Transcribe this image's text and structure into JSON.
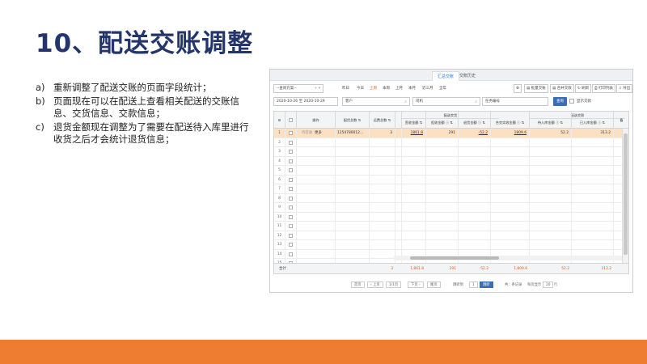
{
  "slide": {
    "title": "10、配送交账调整",
    "bullets": [
      {
        "marker": "a)",
        "text": "重新调整了配送交账的页面字段统计；"
      },
      {
        "marker": "b)",
        "text": "页面现在可以在配送上查看相关配送的交账信息、交货信息、交款信息；"
      },
      {
        "marker": "c)",
        "text": "退货金额现在调整为了需要在配送待入库里进行收货之后才会统计退货信息；"
      }
    ],
    "accent_color": "#ee7d31",
    "title_color": "#24356c"
  },
  "app": {
    "tabs": [
      "汇总交账",
      "交账历史"
    ],
    "active_tab": "汇总交账",
    "scheme_select": "--查询方案--",
    "quick_dates": [
      "昨日",
      "今日",
      "上周",
      "本周",
      "上月",
      "本月",
      "近三月",
      "全年"
    ],
    "active_quick_date": "上周",
    "toolbar_buttons": [
      "批量交账",
      "合并交款",
      "刷新",
      "打印列表",
      "导出"
    ],
    "date_range": "2020-10-26  至  2020-10-29",
    "customer_placeholder": "客户",
    "driver_placeholder": "司机",
    "order_placeholder": "任务编号",
    "query_button": "查询",
    "show_voided_label": "显示交款",
    "grid": {
      "group_headers": [
        "配送交货",
        "配送交款"
      ],
      "headers": [
        "",
        "",
        "操作",
        "配货总数",
        "运费总数",
        "",
        "签收金额",
        "拒收金额",
        "退货金额",
        "合交实收金额",
        "待入库金额",
        "已入库金额",
        "备"
      ],
      "row_numbers": [
        "1",
        "2",
        "3",
        "4",
        "5",
        "6",
        "7",
        "8",
        "9",
        "10",
        "11",
        "12",
        "13",
        "14",
        "15"
      ],
      "selected_row": {
        "op_a": "待签收",
        "op_b": "更多",
        "order": "1254780012...",
        "count": "3",
        "sign": "1861.8",
        "reject": "291",
        "ret": "-52.2",
        "actual": "1809.6",
        "pending": "52.2",
        "stocked": "313.2"
      },
      "summary": {
        "label": "合计",
        "count": "3",
        "sign": "1,861.8",
        "reject": "291",
        "ret": "-52.2",
        "actual": "1,809.6",
        "pending": "52.2",
        "stocked": "313.2"
      }
    },
    "pager": {
      "first": "首页",
      "prev": "上页",
      "page_info": "1/1页",
      "next": "下页",
      "last": "尾页",
      "jump_label": "跳转到",
      "jump_value": "1",
      "go_button": "跳转",
      "total": "共：条记录",
      "page_size_label": "每页显示",
      "page_size": "20",
      "unit": "行"
    }
  }
}
